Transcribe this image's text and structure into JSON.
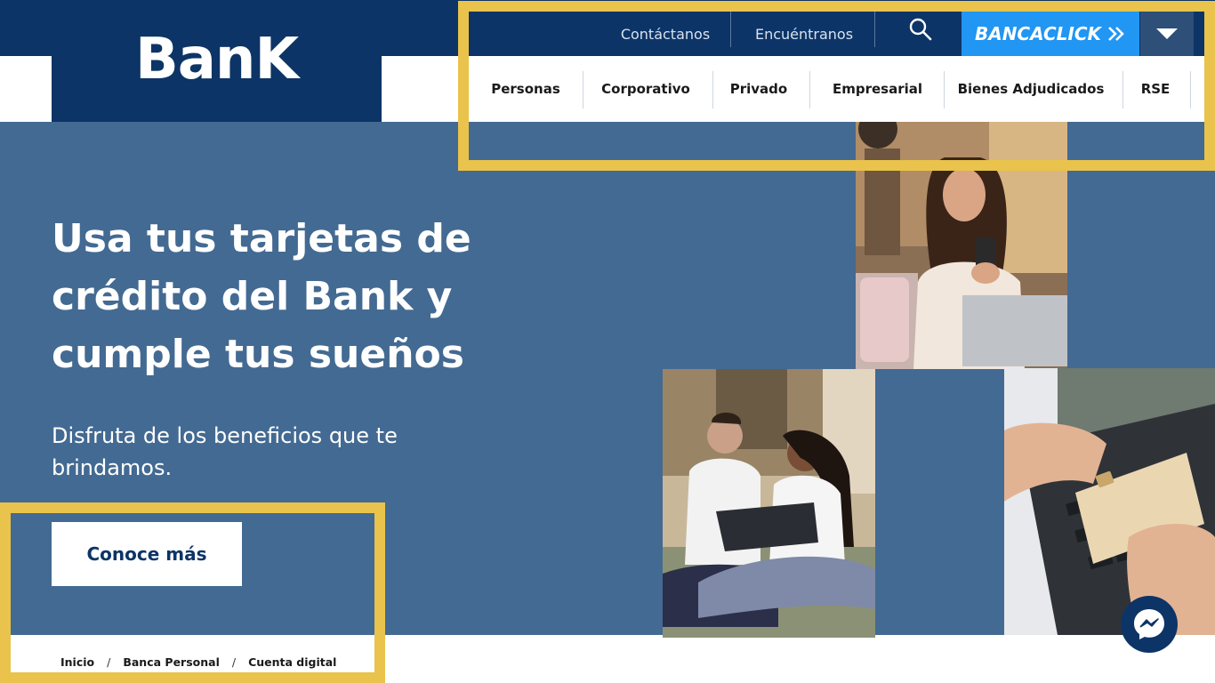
{
  "brand": {
    "logo": "BanK"
  },
  "utility_nav": {
    "contact": "Contáctanos",
    "find_us": "Encuéntranos",
    "bancaclick": "BANCACLICK"
  },
  "main_nav": [
    "Personas",
    "Corporativo",
    "Privado",
    "Empresarial",
    "Bienes Adjudicados",
    "RSE"
  ],
  "hero": {
    "title": "Usa tus tarjetas de crédito del Bank y cumple tus sueños",
    "subtitle": "Disfruta de los beneficios que te brindamos.",
    "cta": "Conoce más"
  },
  "breadcrumb": [
    "Inicio",
    "Banca Personal",
    "Cuenta digital"
  ],
  "colors": {
    "navy": "#0d3466",
    "hero_blue": "#436a92",
    "bancaclick_blue": "#2196f3",
    "highlight": "#e9c34b"
  },
  "icons": [
    "search-icon",
    "double-chevron-right-icon",
    "caret-down-icon",
    "messenger-icon"
  ]
}
